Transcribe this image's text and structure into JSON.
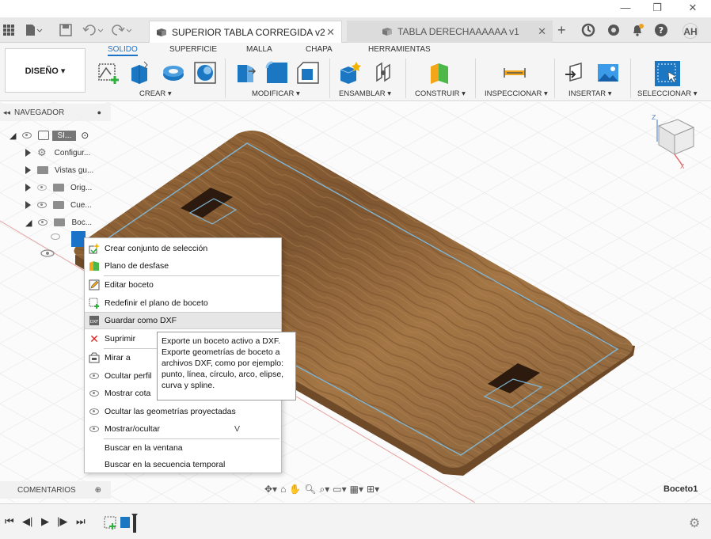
{
  "window": {
    "minimize": "—",
    "restore": "❐",
    "close": "✕"
  },
  "tabs": [
    {
      "label": "SUPERIOR TABLA CORREGIDA v2",
      "close": "✕"
    },
    {
      "label": "TABLA DERECHAAAAAA v1",
      "close": "✕"
    }
  ],
  "user": {
    "initials": "AH"
  },
  "workspace": {
    "label": "DISEÑO ▾"
  },
  "ribbon_tabs": [
    "SOLIDO",
    "SUPERFICIE",
    "MALLA",
    "CHAPA",
    "HERRAMIENTAS"
  ],
  "groups": [
    "CREAR ▾",
    "MODIFICAR ▾",
    "ENSAMBLAR ▾",
    "CONSTRUIR ▾",
    "INSPECCIONAR ▾",
    "INSERTAR ▾",
    "SELECCIONAR ▾"
  ],
  "browser": {
    "title": "NAVEGADOR",
    "root": "SI...",
    "items": [
      "Configur...",
      "Vistas gu...",
      "Orig...",
      "Cue...",
      "Boc..."
    ]
  },
  "context_menu": [
    {
      "label": "Crear conjunto de selección"
    },
    {
      "label": "Plano de desfase"
    },
    {
      "label": "Editar boceto"
    },
    {
      "label": "Redefinir el plano de boceto"
    },
    {
      "label": "Guardar como DXF"
    },
    {
      "label": "Suprimir"
    },
    {
      "label": "Mirar a"
    },
    {
      "label": "Ocultar perfil"
    },
    {
      "label": "Mostrar cota"
    },
    {
      "label": "Ocultar las geometrías proyectadas"
    },
    {
      "label": "Mostrar/ocultar",
      "shortcut": "V"
    },
    {
      "label": "Buscar en la ventana"
    },
    {
      "label": "Buscar en la secuencia temporal"
    }
  ],
  "tooltip": "Exporte un boceto activo a DXF. Exporte geometrías de boceto a archivos DXF, como por ejemplo: punto, línea, círculo, arco, elipse, curva y spline.",
  "comments": {
    "title": "COMENTARIOS"
  },
  "status": {
    "active_sketch": "Boceto1"
  },
  "colors": {
    "accent": "#1a73c8",
    "wood": "#8b6238",
    "sketch_line": "#7fb6d6"
  }
}
